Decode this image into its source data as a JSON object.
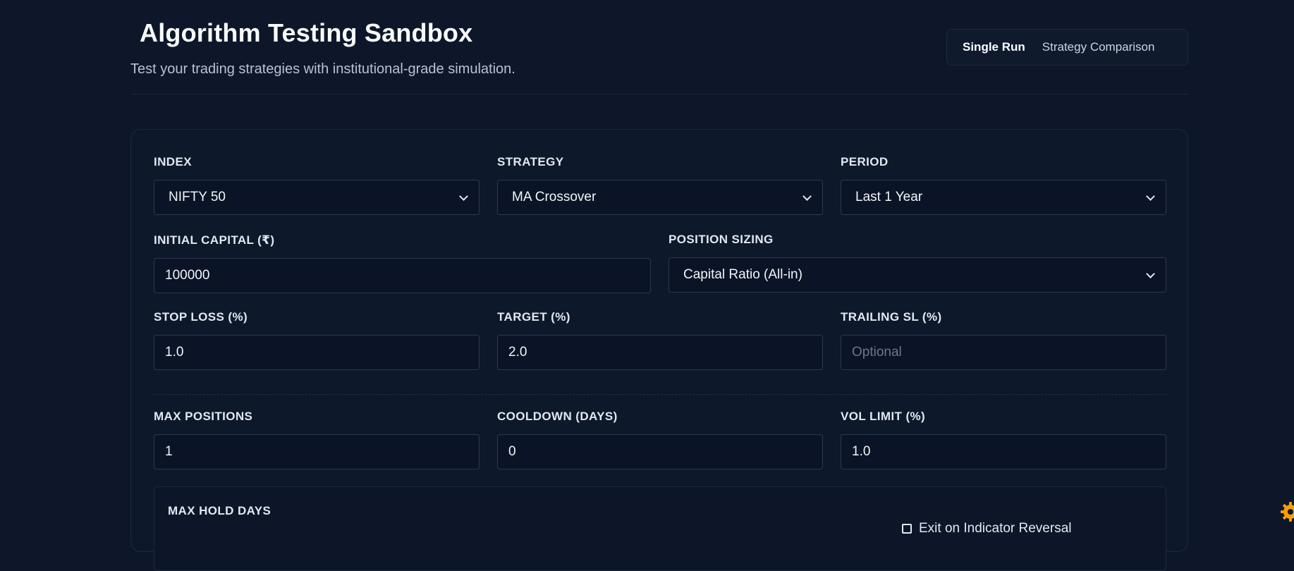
{
  "header": {
    "title": "Algorithm Testing Sandbox",
    "subtitle": "Test your trading strategies with institutional-grade simulation."
  },
  "tabs": [
    {
      "label": "Single Run",
      "active": true
    },
    {
      "label": "Strategy Comparison",
      "active": false
    }
  ],
  "form": {
    "index": {
      "label": "INDEX",
      "value": "NIFTY 50"
    },
    "strategy": {
      "label": "STRATEGY",
      "value": "MA Crossover"
    },
    "period": {
      "label": "PERIOD",
      "value": "Last 1 Year"
    },
    "initial_capital": {
      "label": "INITIAL CAPITAL (₹)",
      "value": "100000"
    },
    "position_sizing": {
      "label": "POSITION SIZING",
      "value": "Capital Ratio (All-in)"
    },
    "stop_loss": {
      "label": "STOP LOSS (%)",
      "value": "1.0"
    },
    "target": {
      "label": "TARGET (%)",
      "value": "2.0"
    },
    "trailing_sl": {
      "label": "TRAILING SL (%)",
      "value": "",
      "placeholder": "Optional"
    },
    "max_positions": {
      "label": "MAX POSITIONS",
      "value": "1"
    },
    "cooldown": {
      "label": "COOLDOWN (DAYS)",
      "value": "0"
    },
    "vol_limit": {
      "label": "VOL LIMIT (%)",
      "value": "1.0"
    },
    "max_hold_days": {
      "label": "MAX HOLD DAYS"
    },
    "exit_toggle": {
      "label": "Exit on Indicator Reversal",
      "checked": false
    }
  },
  "colors": {
    "background": "#0e172a",
    "card": "#0e182b",
    "border": "#2b3850",
    "text": "#f1f5f9",
    "muted": "#b8c2d2",
    "badge": "#f59e0b"
  }
}
